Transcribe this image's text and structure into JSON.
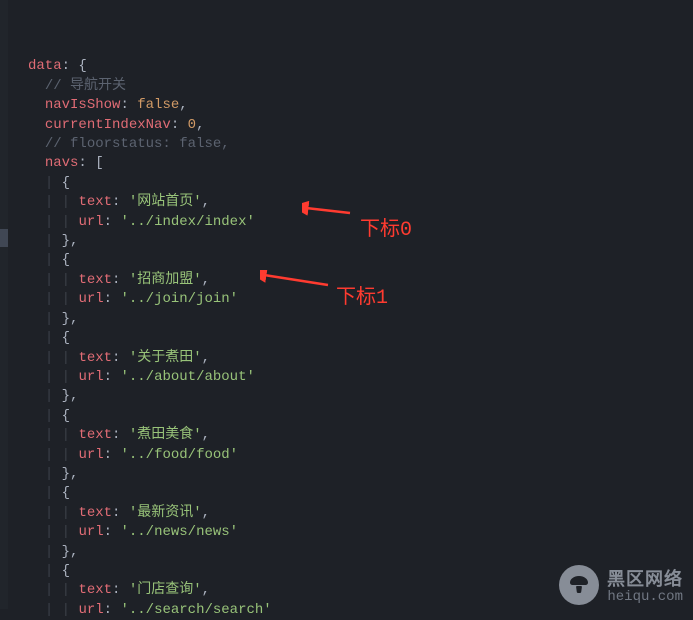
{
  "code": {
    "dataKey": "data",
    "openBrace": "{",
    "comment1": "// 导航开关",
    "navIsShowKey": "navIsShow",
    "navIsShowVal": "false",
    "currentIndexNavKey": "currentIndexNav",
    "currentIndexNavVal": "0",
    "comment2": "// floorstatus: false,",
    "navsKey": "navs",
    "openBracket": "[",
    "items": [
      {
        "text": "'网站首页'",
        "url": "'../index/index'"
      },
      {
        "text": "'招商加盟'",
        "url": "'../join/join'"
      },
      {
        "text": "'关于煮田'",
        "url": "'../about/about'"
      },
      {
        "text": "'煮田美食'",
        "url": "'../food/food'"
      },
      {
        "text": "'最新资讯'",
        "url": "'../news/news'"
      },
      {
        "text": "'门店查询'",
        "url": "'../search/search'"
      }
    ],
    "textLabel": "text",
    "urlLabel": "url",
    "colon": ":",
    "comma": ",",
    "objOpen": "{",
    "objClose": "}"
  },
  "annotations": {
    "label0": "下标0",
    "label1": "下标1"
  },
  "watermark": {
    "name": "黑区网络",
    "domain": "heiqu.com"
  }
}
